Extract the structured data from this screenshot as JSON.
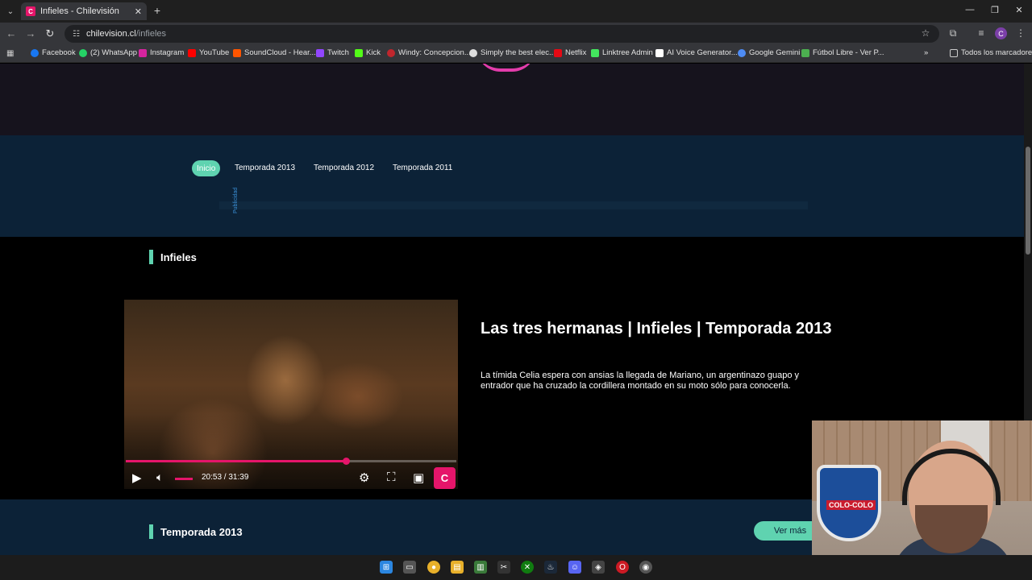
{
  "browser": {
    "tab_title": "Infieles - Chilevisión",
    "tab_favicon": "chv-favicon-icon",
    "url_host": "chilevision.cl",
    "url_path": "/infieles",
    "bookmarks": [
      {
        "label": "Facebook",
        "color": "#1877f2"
      },
      {
        "label": "(2) WhatsApp",
        "color": "#25d366"
      },
      {
        "label": "Instagram",
        "color": "#d6249f"
      },
      {
        "label": "YouTube",
        "color": "#ff0000"
      },
      {
        "label": "SoundCloud - Hear...",
        "color": "#ff5500"
      },
      {
        "label": "Twitch",
        "color": "#9146ff"
      },
      {
        "label": "Kick",
        "color": "#53fc18"
      },
      {
        "label": "Windy: Concepcion...",
        "color": "#c0262d"
      },
      {
        "label": "Simply the best elec...",
        "color": "#dddddd"
      },
      {
        "label": "Netflix",
        "color": "#e50914"
      },
      {
        "label": "Linktree Admin",
        "color": "#43e55e"
      },
      {
        "label": "AI Voice Generator...",
        "color": "#ffffff"
      },
      {
        "label": "Google Gemini",
        "color": "#4e8cf5"
      },
      {
        "label": "Fútbol Libre - Ver P...",
        "color": "#4caf50"
      }
    ],
    "all_bookmarks": "Todos los marcadores",
    "profile_initial": "C"
  },
  "site": {
    "accent": "#5fd3b0",
    "brand": "#e5156a",
    "nav": {
      "active": "Inicio",
      "links": [
        "Temporada 2013",
        "Temporada 2012",
        "Temporada 2011"
      ]
    },
    "ad_label": "Publicidad",
    "section_title": "Infieles",
    "player": {
      "time": "20:53 / 31:39",
      "progress": 0.665
    },
    "episode": {
      "title": "Las tres hermanas | Infieles | Temporada 2013",
      "description": "La tímida Celia espera con ansias la llegada de Mariano, un argentinazo guapo y entrador que ha cruzado la cordillera montado en su moto sólo para conocerla."
    },
    "season_section": {
      "title": "Temporada 2013",
      "more_button": "Ver más"
    }
  },
  "webcam": {
    "shield_text": "COLO-COLO"
  }
}
